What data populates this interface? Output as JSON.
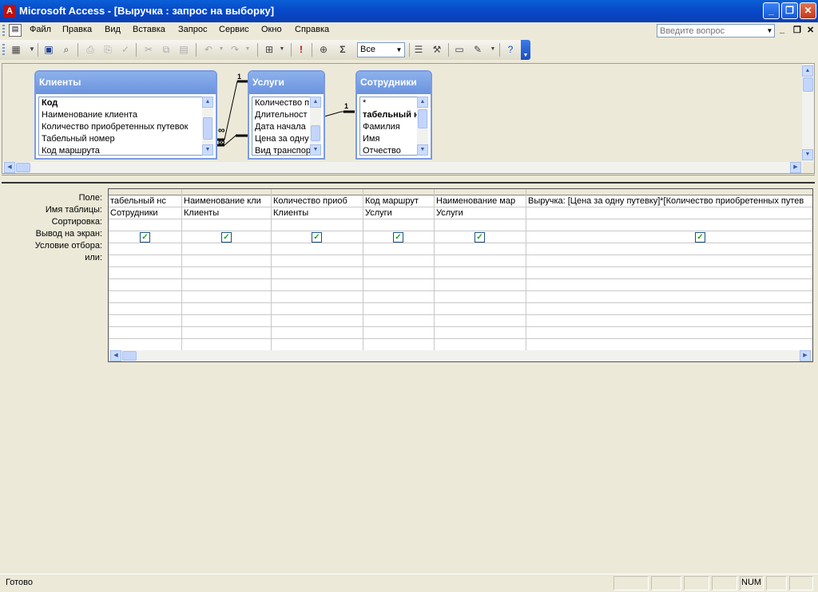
{
  "window": {
    "title": "Microsoft Access - [Выручка : запрос на выборку]"
  },
  "menu": {
    "items": [
      "Файл",
      "Правка",
      "Вид",
      "Вставка",
      "Запрос",
      "Сервис",
      "Окно",
      "Справка"
    ]
  },
  "help": {
    "placeholder": "Введите вопрос"
  },
  "toolbar": {
    "top_values": "Все"
  },
  "tables": [
    {
      "name": "Клиенты",
      "fields": [
        "Код",
        "Наименование клиента",
        "Количество приобретенных путевок",
        "Табельный номер",
        "Код маршрута"
      ]
    },
    {
      "name": "Услуги",
      "fields": [
        "Количество п",
        "Длительност",
        "Дата начала",
        "Цена за одну",
        "Вид транспор"
      ]
    },
    {
      "name": "Сотрудники",
      "fields": [
        "*",
        "табельный н",
        "Фамилия",
        "Имя",
        "Отчество"
      ]
    }
  ],
  "joins": {
    "one_a": "1",
    "inf_a": "∞",
    "inf_b": "∞",
    "one_b": "1"
  },
  "qbe": {
    "row_labels": [
      "Поле:",
      "Имя таблицы:",
      "Сортировка:",
      "Вывод на экран:",
      "Условие отбора:",
      "или:"
    ],
    "columns": [
      {
        "field": "табельный нс",
        "table": "Сотрудники",
        "show": true
      },
      {
        "field": "Наименование кли",
        "table": "Клиенты",
        "show": true
      },
      {
        "field": "Количество приоб",
        "table": "Клиенты",
        "show": true
      },
      {
        "field": "Код маршрут",
        "table": "Услуги",
        "show": true
      },
      {
        "field": "Наименование мар",
        "table": "Услуги",
        "show": true
      },
      {
        "field": "Выручка: [Цена за одну путевку]*[Количество приобретенных путев",
        "table": "",
        "show": true
      }
    ]
  },
  "status": {
    "text": "Готово",
    "num": "NUM"
  }
}
